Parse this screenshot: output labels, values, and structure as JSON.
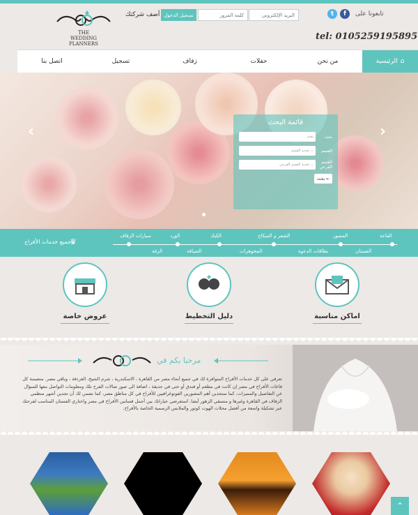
{
  "header": {
    "follow_label": "تابعونا على",
    "email_placeholder": "البريد الإلكتروني",
    "password_placeholder": "كلمة المرور",
    "login_label": "تسجيل الدخول",
    "add_company": "أضف شركتك",
    "logo_line1": "THE",
    "logo_line2": "WEDDING",
    "logo_line3": "PLANNERS",
    "phone": "tel: 0105259195895"
  },
  "nav": {
    "home": "الرئيسية",
    "items": [
      "من نحن",
      "حفلات",
      "زفاف",
      "تسجيل",
      "اتصل بنا"
    ]
  },
  "search": {
    "title": "قائمة البحث",
    "search_label": "بحث",
    "search_placeholder": "بحث",
    "category_label": "القسم",
    "category_value": "تحديد القسم",
    "subcategory_label": "القسم الفرعي",
    "subcategory_value": "تحديد القسم الفرعي",
    "submit": "بحث"
  },
  "services": {
    "top": [
      "القاعة",
      "المصور",
      "الشعر و الميكاج",
      "الكيك",
      "الورد",
      "سيارات الزفاف"
    ],
    "bottom": [
      "الفستان",
      "بطاقات الدعوة",
      "المجوهرات",
      "الضيافة",
      "الزفة"
    ],
    "all_label": "جميع خدمات الأفراح"
  },
  "features": {
    "places": "اماكن مناسبة",
    "guide": "دليل التخطيط",
    "offers": "عروض خاصة"
  },
  "welcome": {
    "title": "مرحبا بكم في",
    "text": "تعرفي على كل خدمات الأفراح المتوافرة لك في جميع أنحاء مصر من القاهرة ، الاسكندرية ، شرم الشيخ، الغردقة ، وباقي مصر. متضمنة كل قاعات الأفراح في مصر إن كانت في مطعم أو فندق أو حتى في حديقة ، اضافة الى صور صالات الفرح تلك ومعلومات التواصل معها للسؤال عن التفاصيل والمميزات، كما ستجدين أهم المصورين الفوتوغرافيين للأفراح في كل مناطق مصر، كما نضمن لك أن تجدين أشهر منظمي الزفاف في القاهرة وغيرها و منسقي الزهور أيضا. استعرضي خياراتك بين أجمل فساتين الأفراح في مصر واختاري الفستان المناسب لفرحتك عبر تشكيلة واسعة من أفضل محلات الهوت كوتور والملابس الرسمية الخاصة بالأفراح."
  },
  "colors": {
    "accent": "#5ec4be"
  }
}
